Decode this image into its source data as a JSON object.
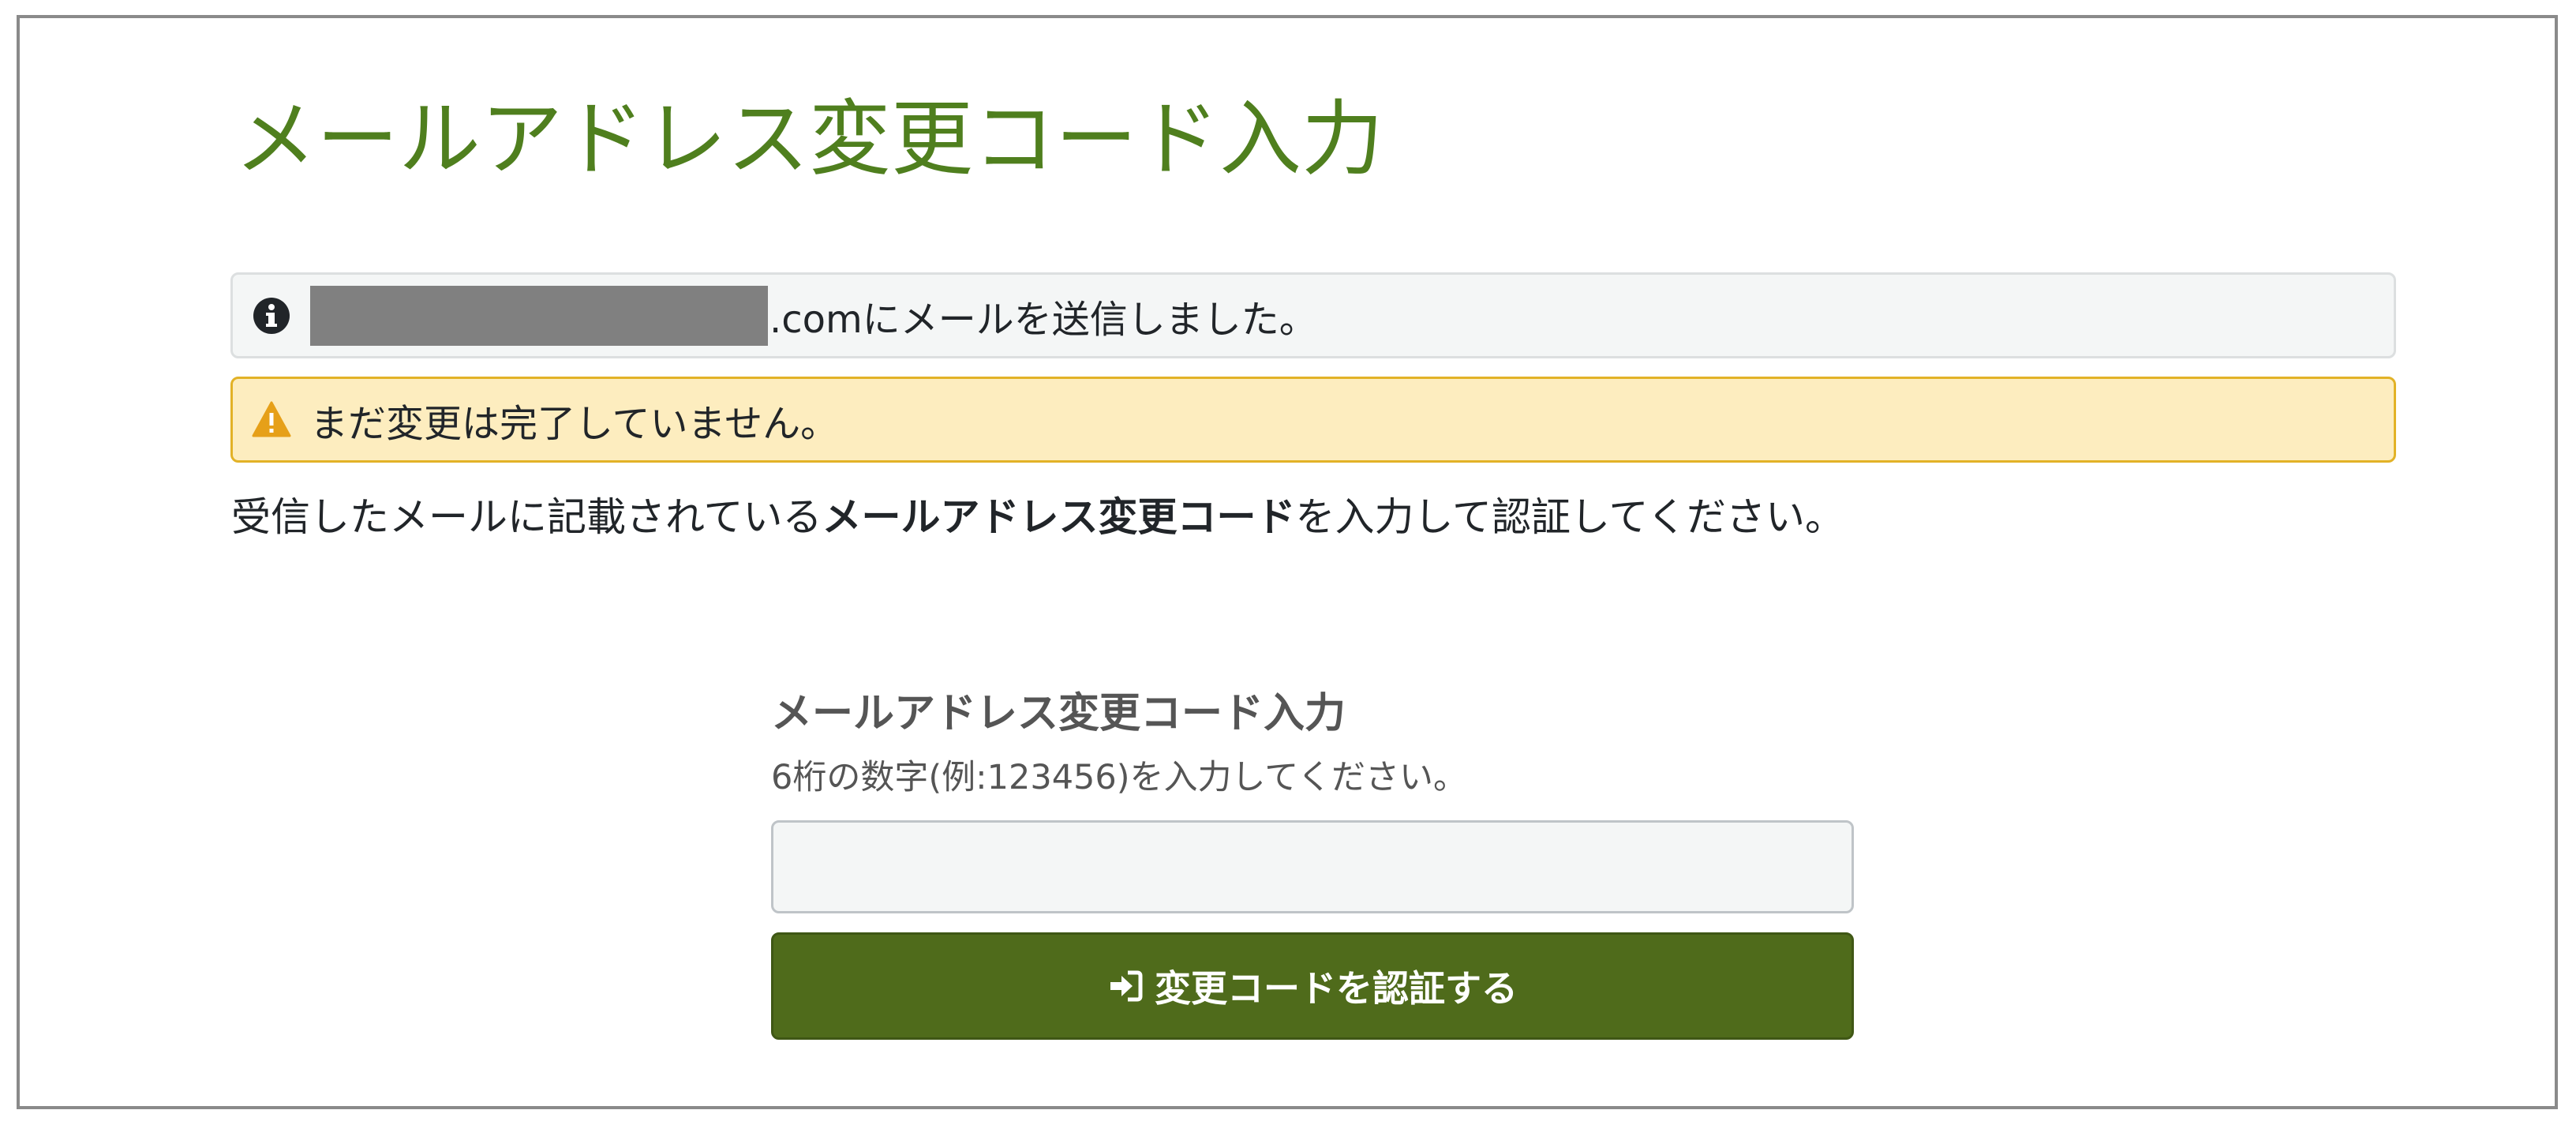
{
  "page": {
    "title": "メールアドレス変更コード入力"
  },
  "alerts": {
    "info": {
      "icon": "info-circle-icon",
      "text": ".comにメールを送信しました。"
    },
    "warning": {
      "icon": "warning-triangle-icon",
      "text": "まだ変更は完了していません。"
    }
  },
  "instruction": {
    "prefix": "受信したメールに記載されている",
    "bold": "メールアドレス変更コード",
    "suffix": "を入力して認証してください。"
  },
  "form": {
    "label": "メールアドレス変更コード入力",
    "hint": "6桁の数字(例:123456)を入力してください。",
    "input_value": "",
    "input_placeholder": "",
    "submit_icon": "sign-in-icon",
    "submit_label": "変更コードを認証する"
  },
  "colors": {
    "title": "#4f7f1e",
    "button": "#4f6b1b",
    "warning_bg": "#fdedbf",
    "warning_border": "#e2b227",
    "info_bg": "#f4f6f6"
  }
}
